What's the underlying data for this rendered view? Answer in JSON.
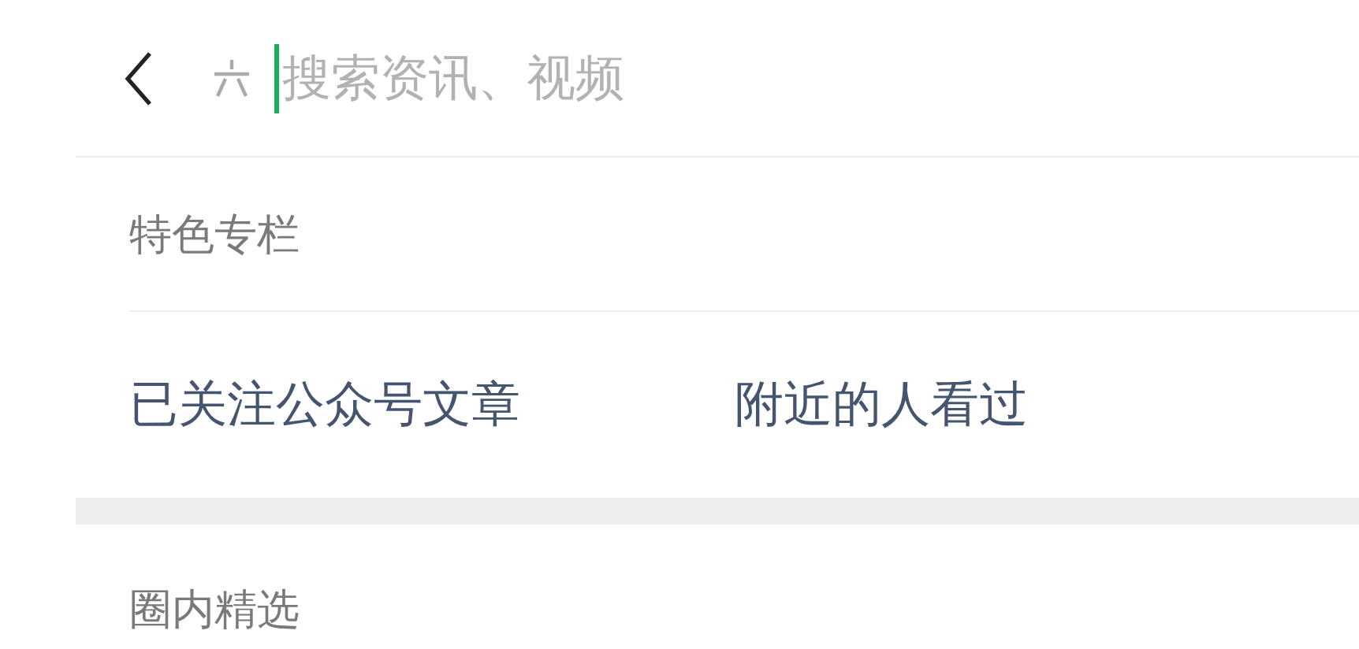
{
  "header": {
    "search": {
      "placeholder": "搜索资讯、视频",
      "focused": true
    }
  },
  "sections": [
    {
      "title": "特色专栏",
      "links": [
        "已关注公众号文章",
        "附近的人看过"
      ]
    },
    {
      "title": "圈内精选"
    }
  ]
}
